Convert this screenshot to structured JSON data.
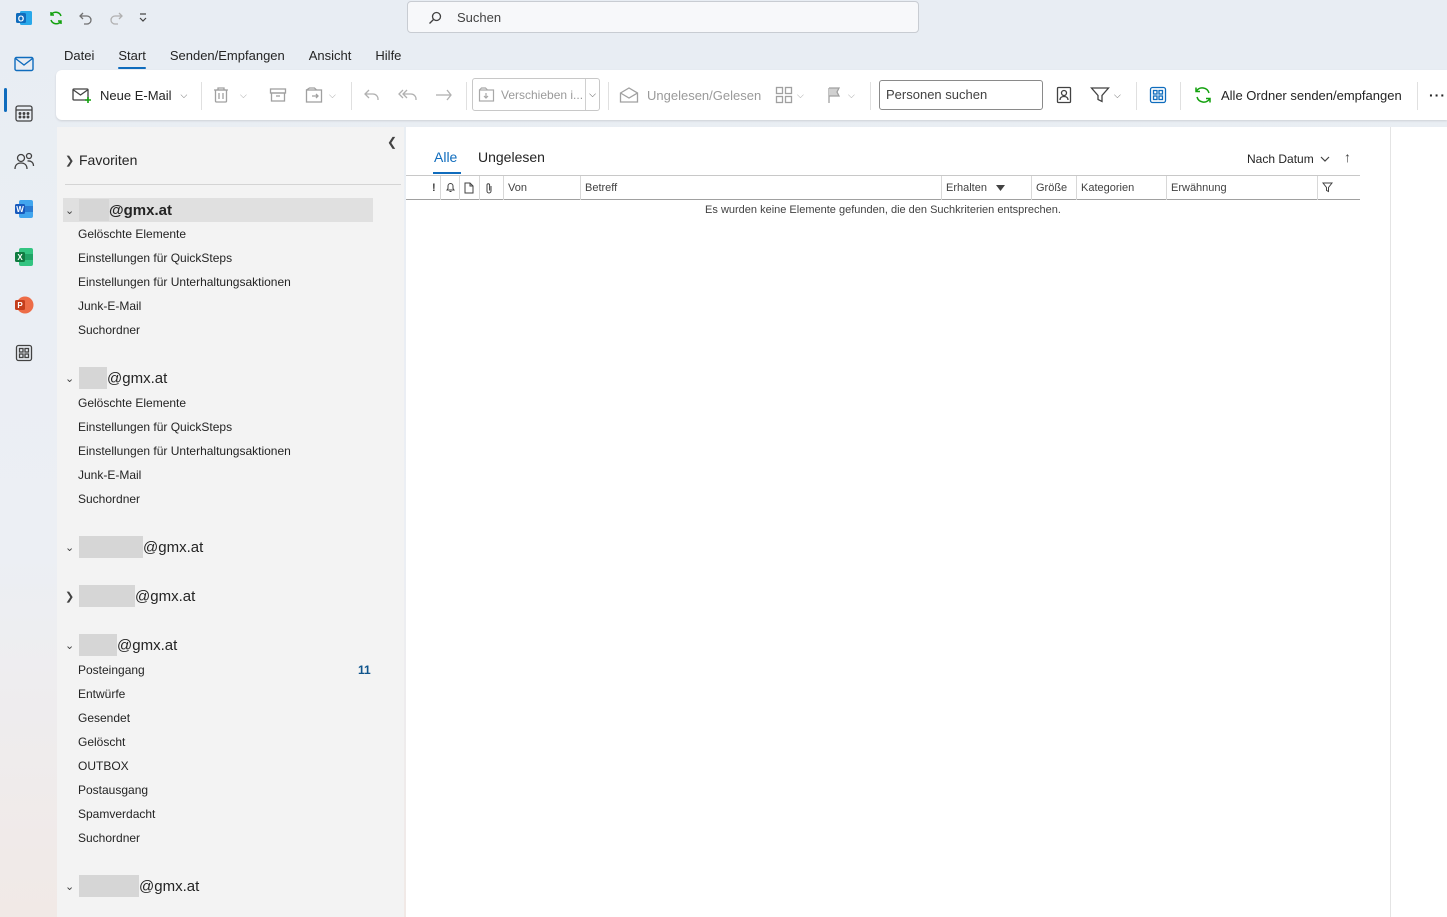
{
  "search": {
    "placeholder": "Suchen"
  },
  "menu_tabs": [
    "Datei",
    "Start",
    "Senden/Empfangen",
    "Ansicht",
    "Hilfe"
  ],
  "active_tab": "Start",
  "ribbon": {
    "new_mail": "Neue E-Mail",
    "move_to": "Verschieben i...",
    "unread_read": "Ungelesen/Gelesen",
    "people_search": "Personen suchen",
    "send_receive_all": "Alle Ordner senden/empfangen",
    "more": "···"
  },
  "folder_pane": {
    "favorites": "Favoriten",
    "accounts": [
      {
        "suffix": "@gmx.at",
        "expanded": true,
        "selected": true,
        "folders": [
          "Gelöschte Elemente",
          "Einstellungen für QuickSteps",
          "Einstellungen für Unterhaltungsaktionen",
          "Junk-E-Mail",
          "Suchordner"
        ]
      },
      {
        "suffix": "@gmx.at",
        "expanded": true,
        "folders": [
          "Gelöschte Elemente",
          "Einstellungen für QuickSteps",
          "Einstellungen für Unterhaltungsaktionen",
          "Junk-E-Mail",
          "Suchordner"
        ]
      },
      {
        "suffix": "@gmx.at",
        "expanded": true,
        "folders": []
      },
      {
        "suffix": "@gmx.at",
        "expanded": false,
        "folders": []
      },
      {
        "suffix": "@gmx.at",
        "expanded": true,
        "folders": [
          "Posteingang",
          "Entwürfe",
          "Gesendet",
          "Gelöscht",
          "OUTBOX",
          "Postausgang",
          "Spamverdacht",
          "Suchordner"
        ],
        "inbox_unread": "11"
      },
      {
        "suffix": "@gmx.at",
        "expanded": true,
        "folders": []
      }
    ]
  },
  "message_list": {
    "filter_all": "Alle",
    "filter_unread": "Ungelesen",
    "sort_by": "Nach Datum",
    "columns": {
      "importance": "!",
      "from": "Von",
      "subject": "Betreff",
      "received": "Erhalten",
      "size": "Größe",
      "categories": "Kategorien",
      "mention": "Erwähnung"
    },
    "empty_text": "Es wurden keine Elemente gefunden, die den Suchkriterien entsprechen."
  },
  "colors": {
    "accent": "#0f6cbd",
    "unread_count": "#0f548c"
  }
}
